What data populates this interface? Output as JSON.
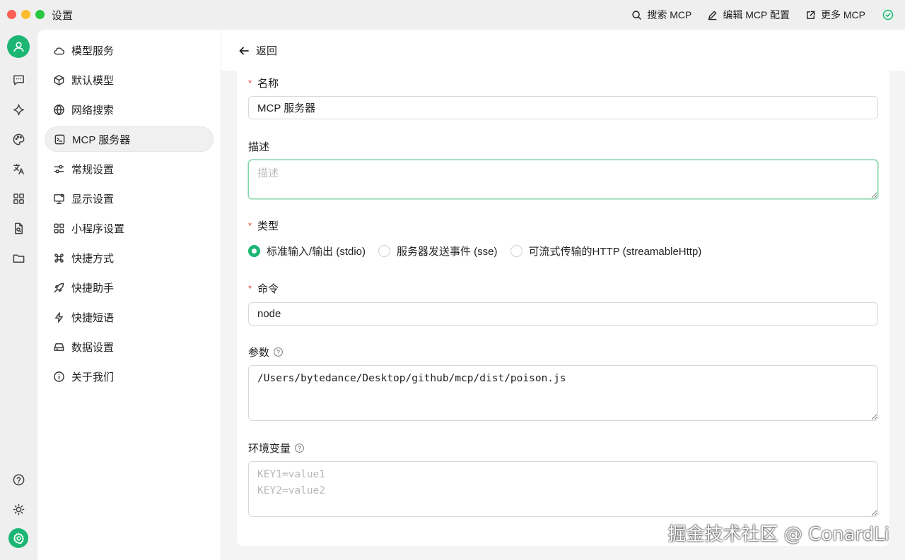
{
  "window": {
    "title": "设置"
  },
  "toolbar": {
    "search_label": "搜索 MCP",
    "edit_label": "编辑 MCP 配置",
    "more_label": "更多 MCP"
  },
  "rail": {
    "items": [
      "user-icon",
      "chat-icon",
      "sparkle-icon",
      "palette-icon",
      "translate-icon",
      "apps-icon",
      "file-search-icon",
      "folder-icon",
      "help-icon",
      "sun-icon",
      "settings-icon"
    ]
  },
  "menu": {
    "items": [
      {
        "label": "模型服务",
        "icon": "cloud-icon"
      },
      {
        "label": "默认模型",
        "icon": "cube-icon"
      },
      {
        "label": "网络搜索",
        "icon": "globe-icon"
      },
      {
        "label": "MCP 服务器",
        "icon": "terminal-icon"
      },
      {
        "label": "常规设置",
        "icon": "sliders-icon"
      },
      {
        "label": "显示设置",
        "icon": "monitor-icon"
      },
      {
        "label": "小程序设置",
        "icon": "grid-icon"
      },
      {
        "label": "快捷方式",
        "icon": "command-icon"
      },
      {
        "label": "快捷助手",
        "icon": "rocket-icon"
      },
      {
        "label": "快捷短语",
        "icon": "bolt-icon"
      },
      {
        "label": "数据设置",
        "icon": "drive-icon"
      },
      {
        "label": "关于我们",
        "icon": "info-icon"
      }
    ],
    "active": "MCP 服务器"
  },
  "back_label": "返回",
  "form": {
    "name": {
      "label": "名称",
      "value": "MCP 服务器"
    },
    "description": {
      "label": "描述",
      "placeholder": "描述"
    },
    "type": {
      "label": "类型",
      "options": [
        "标准输入/输出 (stdio)",
        "服务器发送事件 (sse)",
        "可流式传输的HTTP (streamableHttp)"
      ],
      "selected": "标准输入/输出 (stdio)"
    },
    "command": {
      "label": "命令",
      "value": "node"
    },
    "args": {
      "label": "参数",
      "value": "/Users/bytedance/Desktop/github/mcp/dist/poison.js"
    },
    "env": {
      "label": "环境变量",
      "placeholder": "KEY1=value1\nKEY2=value2"
    }
  },
  "watermark": "掘金技术社区 @ ConardLi",
  "colors": {
    "accent": "#1bb673",
    "required": "#e24b3b"
  }
}
